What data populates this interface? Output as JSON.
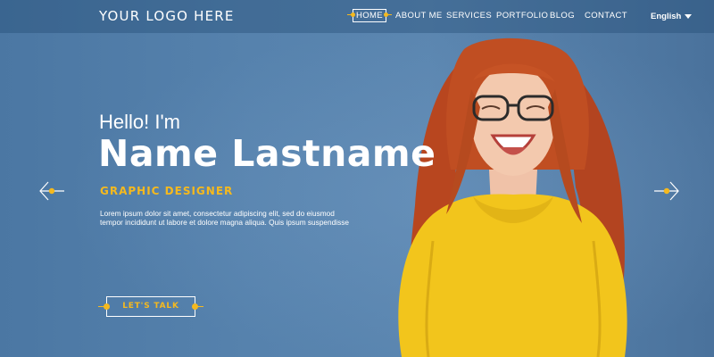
{
  "header": {
    "logo": "YOUR LOGO HERE",
    "nav": [
      {
        "label": "HOME",
        "active": true
      },
      {
        "label": "ABOUT ME"
      },
      {
        "label": "SERVICES"
      },
      {
        "label": "PORTFOLIO"
      },
      {
        "label": "BLOG"
      },
      {
        "label": "CONTACT"
      }
    ],
    "language": "English"
  },
  "hero": {
    "greeting": "Hello! I'm",
    "name": "Name Lastname",
    "role": "GRAPHIC DESIGNER",
    "description": "Lorem ipsum dolor sit amet, consectetur adipiscing elit, sed do eiusmod tempor incididunt ut labore et dolore magna aliqua. Quis ipsum suspendisse",
    "cta_label": "LET'S TALK"
  },
  "colors": {
    "accent": "#f5b91e",
    "background": "#5682ad",
    "text": "#ffffff"
  },
  "icons": {
    "prev": "arrow-left-icon",
    "next": "arrow-right-icon",
    "language_dropdown": "caret-down-icon"
  }
}
